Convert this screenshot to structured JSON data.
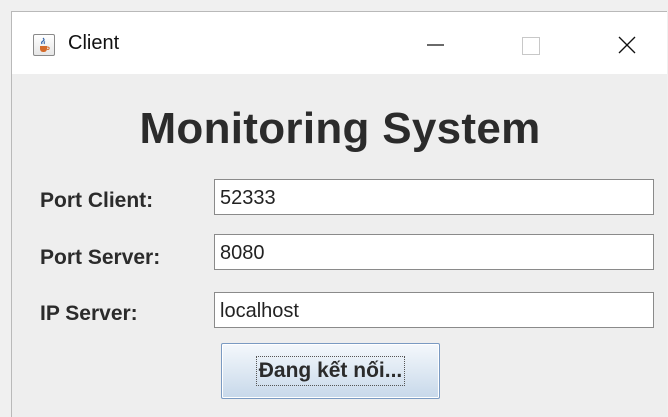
{
  "window": {
    "title": "Client",
    "app_icon": "java-cup-icon",
    "controls": {
      "minimize": "minimize-icon",
      "maximize": "maximize-icon",
      "close": "close-icon"
    }
  },
  "main": {
    "heading": "Monitoring System",
    "fields": [
      {
        "label": "Port Client:",
        "value": "52333"
      },
      {
        "label": "Port Server:",
        "value": "8080"
      },
      {
        "label": "IP Server:",
        "value": "localhost"
      }
    ],
    "connect_button": "Đang kết nối..."
  },
  "colors": {
    "window_bg": "#eeeeee",
    "titlebar_bg": "#ffffff",
    "button_border": "#7a9ac2",
    "text": "#2b2b2b"
  }
}
